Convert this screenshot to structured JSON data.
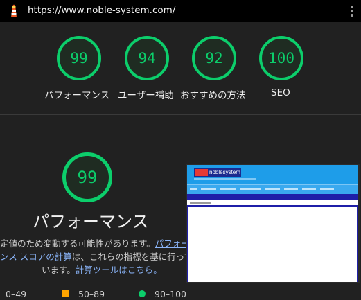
{
  "browser": {
    "url": "https://www.noble-system.com/"
  },
  "scores": [
    {
      "value": "99",
      "label": "パフォーマンス"
    },
    {
      "value": "94",
      "label": "ユーザー補助"
    },
    {
      "value": "92",
      "label": "おすすめの方法"
    },
    {
      "value": "100",
      "label": "SEO"
    }
  ],
  "performance": {
    "score": "99",
    "title": "パフォーマンス",
    "desc_line1": "定値のため変動する可能性があります。",
    "desc_line1_link": "パフォー",
    "desc_line2_link": "ンス スコアの計算",
    "desc_line2": "は、これらの指標を基に行って",
    "desc_line3": "います。",
    "desc_line3_link": "計算ツールはこちら。"
  },
  "legend": {
    "fail": "0–49",
    "average": "50–89",
    "pass": "90–100"
  },
  "thumbnail": {
    "site_logo_text": "noblesystem"
  },
  "colors": {
    "pass": "#0cce6b",
    "average": "#ffa400",
    "link": "#8ab4f8"
  }
}
